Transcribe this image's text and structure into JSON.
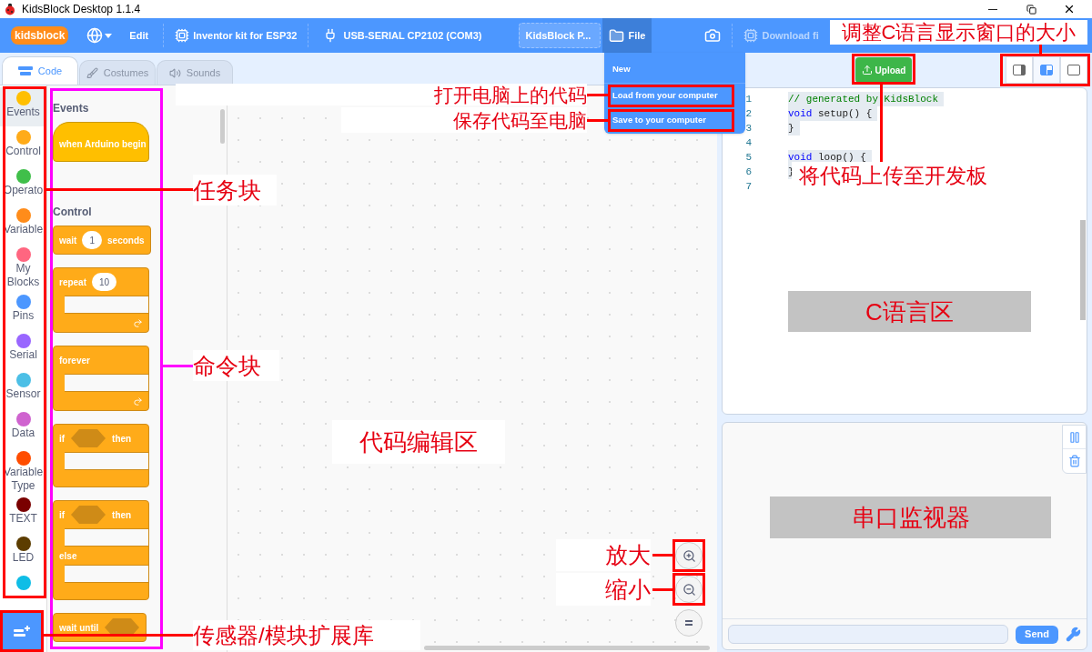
{
  "window": {
    "title": "KidsBlock Desktop 1.1.4"
  },
  "menu_bar": {
    "logo": "kidsblock",
    "edit": "Edit",
    "device": "Inventor kit for ESP32",
    "port": "USB-SERIAL CP2102 (COM3)",
    "project_title": "KidsBlock P...",
    "file": {
      "label": "File",
      "selected": true
    },
    "download": {
      "label": "Download fi",
      "disabled": true
    }
  },
  "file_menu": [
    {
      "label": "New",
      "highlighted": false
    },
    {
      "label": "Load from your computer",
      "highlighted": true
    },
    {
      "label": "Save to your computer",
      "highlighted": true
    }
  ],
  "tabs": [
    {
      "kind": "code",
      "label": "Code",
      "selected": true
    },
    {
      "kind": "costumes",
      "label": "Costumes",
      "selected": false
    },
    {
      "kind": "sounds",
      "label": "Sounds",
      "selected": false
    }
  ],
  "categories": [
    {
      "label": "Events",
      "color": "#ffbf00",
      "selected": true
    },
    {
      "label": "Control",
      "color": "#ffab19",
      "selected": false
    },
    {
      "label": "Operato",
      "color": "#40bf4a",
      "selected": false
    },
    {
      "label": "Variable",
      "color": "#ff8c1a",
      "selected": false
    },
    {
      "label": "My Blocks",
      "color": "#ff6680",
      "selected": false
    },
    {
      "label": "Pins",
      "color": "#4c97ff",
      "selected": false
    },
    {
      "label": "Serial",
      "color": "#9966ff",
      "selected": false
    },
    {
      "label": "Sensor",
      "color": "#4cbfe6",
      "selected": false
    },
    {
      "label": "Data",
      "color": "#cf63cf",
      "selected": false
    },
    {
      "label": "Variable Type",
      "color": "#ff4d00",
      "selected": false
    },
    {
      "label": "TEXT",
      "color": "#7a0000",
      "selected": false
    },
    {
      "label": "LED",
      "color": "#5c3d00",
      "selected": false
    },
    {
      "color": "#0fbde6",
      "selected": false
    }
  ],
  "palette": {
    "sections": [
      {
        "title": "Events",
        "blocks": [
          {
            "kind": "hat",
            "parts": [
              {
                "kind": "text",
                "text": "when Arduino begin"
              }
            ]
          }
        ]
      },
      {
        "title": "Control",
        "blocks": [
          {
            "kind": "stack",
            "parts": [
              {
                "kind": "text",
                "text": "wait"
              },
              {
                "kind": "number",
                "text": "1"
              },
              {
                "kind": "text",
                "text": "seconds"
              }
            ]
          },
          {
            "kind": "loop",
            "parts": [
              {
                "kind": "text",
                "text": "repeat"
              },
              {
                "kind": "number",
                "text": "10"
              }
            ]
          },
          {
            "kind": "loop",
            "parts": [
              {
                "kind": "text",
                "text": "forever"
              }
            ]
          },
          {
            "kind": "if",
            "parts": [
              {
                "kind": "text",
                "text": "if"
              },
              {
                "kind": "slot"
              },
              {
                "kind": "text",
                "text": "then"
              }
            ]
          },
          {
            "kind": "if_else",
            "parts": [
              {
                "kind": "text",
                "text": "if"
              },
              {
                "kind": "slot"
              },
              {
                "kind": "text",
                "text": "then"
              }
            ],
            "else": "else"
          },
          {
            "kind": "stack",
            "parts": [
              {
                "kind": "text",
                "text": "wait until"
              },
              {
                "kind": "slot"
              }
            ]
          }
        ]
      }
    ]
  },
  "toolbar": {
    "upload": "Upload",
    "layout_buttons": [
      {
        "kind": "side",
        "selected": false
      },
      {
        "kind": "split",
        "selected": true
      },
      {
        "kind": "full",
        "selected": false
      }
    ]
  },
  "code_editor": {
    "lines": [
      {
        "number": "1",
        "selected": true,
        "tokens": [
          {
            "kind": "comment",
            "text": "// generated by KidsBlock"
          }
        ]
      },
      {
        "number": "2",
        "selected": true,
        "tokens": [
          {
            "kind": "keyword",
            "text": "void"
          },
          {
            "kind": "plain",
            "text": " setup() {"
          }
        ]
      },
      {
        "number": "3",
        "selected": true,
        "tokens": [
          {
            "kind": "plain",
            "text": "}"
          }
        ]
      },
      {
        "number": "4",
        "selected": false
      },
      {
        "number": "5",
        "selected": true,
        "tokens": [
          {
            "kind": "keyword",
            "text": "void"
          },
          {
            "kind": "plain",
            "text": " loop() {"
          }
        ]
      },
      {
        "number": "6",
        "selected": true,
        "tokens": [
          {
            "kind": "plain",
            "text": "}"
          }
        ]
      },
      {
        "number": "7",
        "selected": false
      }
    ]
  },
  "serial_monitor": {
    "send": "Send"
  },
  "annotations": [
    {
      "text": "打开电脑上的代码"
    },
    {
      "text": "保存代码至电脑"
    },
    {
      "text": "调整C语言显示窗口的大小"
    },
    {
      "text": "将代码上传至开发板"
    },
    {
      "text": "任务块"
    },
    {
      "text": "命令块"
    },
    {
      "text": "C语言区"
    },
    {
      "text": "代码编辑区"
    },
    {
      "text": "串口监视器"
    },
    {
      "text": "放大"
    },
    {
      "text": "缩小"
    },
    {
      "text": "传感器/模块扩展库"
    }
  ]
}
